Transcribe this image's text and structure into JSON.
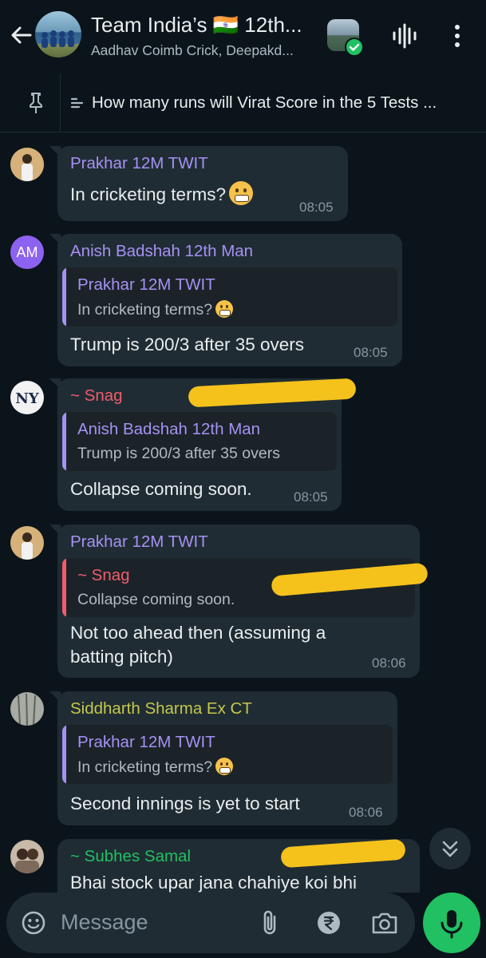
{
  "header": {
    "title": "Team India’s 🇮🇳 12th...",
    "subtitle": "Aadhav Coimb Crick, Deepakd..."
  },
  "pinned": {
    "text": "How many runs will Virat Score in the 5 Tests ..."
  },
  "messages": [
    {
      "sender": "Prakhar 12M TWIT",
      "sender_color": "#a691f4",
      "text": "In cricketing terms?",
      "time": "08:05"
    },
    {
      "sender": "Anish Badshah 12th Man",
      "sender_color": "#a691f4",
      "avatar_initials": "AM",
      "quote": {
        "name": "Prakhar 12M TWIT",
        "text": "In cricketing terms?"
      },
      "text": "Trump is 200/3 after 35 overs",
      "time": "08:05"
    },
    {
      "sender": "~ Snag",
      "sender_color": "#f15c6d",
      "quote": {
        "name": "Anish Badshah 12th Man",
        "text": "Trump is 200/3 after 35 overs"
      },
      "text": "Collapse coming soon.",
      "time": "08:05"
    },
    {
      "sender": "Prakhar 12M TWIT",
      "sender_color": "#a691f4",
      "quote": {
        "name": "~ Snag",
        "text": "Collapse coming soon."
      },
      "text_line1": "Not too ahead then (assuming a",
      "text_line2": "batting pitch)",
      "time": "08:06"
    },
    {
      "sender": "Siddharth Sharma Ex CT",
      "sender_color": "#c4c84a",
      "quote": {
        "name": "Prakhar 12M TWIT",
        "text": "In cricketing terms?"
      },
      "text": "Second innings is yet to start",
      "time": "08:06"
    },
    {
      "sender": "~ Subhes Samal",
      "sender_color": "#21c063",
      "text": "Bhai stock upar jana chahiye koi bhi"
    }
  ],
  "input": {
    "placeholder": "Message"
  },
  "colors": {
    "background": "#0b141a",
    "bubble": "#202c33",
    "accent_green": "#21c063",
    "quote_bar_purple": "#a691f4",
    "quote_bar_red": "#f15c6d"
  },
  "icons": [
    "back-arrow-icon",
    "voice-chat-icon",
    "more-options-icon",
    "pin-icon",
    "poll-icon",
    "emoji-icon",
    "attach-icon",
    "rupee-icon",
    "camera-icon",
    "mic-icon",
    "scroll-down-icon"
  ]
}
